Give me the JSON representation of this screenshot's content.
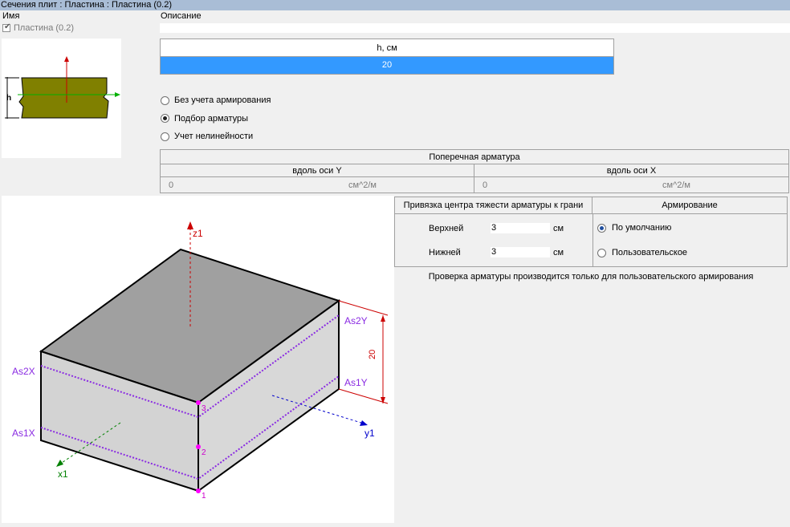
{
  "window": {
    "title": "Сечения плит : Пластина : Пластина (0.2)"
  },
  "left": {
    "name_label": "Имя",
    "checkbox_label": "Пластина (0.2)",
    "checkbox_checked": true,
    "section_h_label": "h"
  },
  "description": {
    "label": "Описание",
    "value": ""
  },
  "thickness_table": {
    "header": "h, см",
    "value": "20"
  },
  "calc_mode": {
    "options": [
      "Без учета армирования",
      "Подбор арматуры",
      "Учет нелинейности"
    ],
    "selected_index": 1
  },
  "transverse": {
    "title": "Поперечная арматура",
    "col_y": "вдоль оси Y",
    "col_x": "вдоль оси X",
    "value_y": "0",
    "unit_y": "см^2/м",
    "value_x": "0",
    "unit_x": "см^2/м"
  },
  "binding": {
    "header": "Привязка центра тяжести арматуры к грани",
    "top_label": "Верхней",
    "top_value": "3",
    "top_unit": "см",
    "bottom_label": "Нижней",
    "bottom_value": "3",
    "bottom_unit": "см"
  },
  "reinforcement": {
    "header": "Армирование",
    "options": [
      "По умолчанию",
      "Пользовательское"
    ],
    "selected_index": 0
  },
  "note": "Проверка арматуры производится только для пользовательского армирования",
  "diagram": {
    "axis_z": "z1",
    "axis_x": "x1",
    "axis_y": "y1",
    "as2x": "As2X",
    "as1x": "As1X",
    "as2y": "As2Y",
    "as1y": "As1Y",
    "thickness": "20",
    "point1": "1",
    "point2": "2",
    "point3": "3"
  },
  "colors": {
    "accent_blue": "#3399ff",
    "title_bar": "#a9bdd6",
    "plate_olive": "#808000",
    "rebar_purple": "#8a2be2",
    "axis_red": "#cc0000",
    "axis_green": "#008000",
    "axis_blue": "#0000cc",
    "point_magenta": "#ff00ff"
  }
}
